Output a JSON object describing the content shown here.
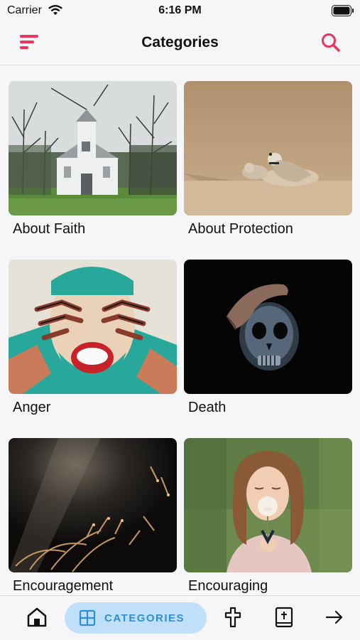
{
  "status": {
    "carrier": "Carrier",
    "time": "6:16 PM"
  },
  "header": {
    "title": "Categories"
  },
  "colors": {
    "accent": "#e8355a",
    "nav_active_bg": "#bfe0f8",
    "nav_active_fg": "#2f8fd4"
  },
  "categories": [
    {
      "label": "About Faith",
      "image": "white wooden chapel among bare trees"
    },
    {
      "label": "About Protection",
      "image": "two small birds on sand"
    },
    {
      "label": "Anger",
      "image": "graffiti of screaming face with hands"
    },
    {
      "label": "Death",
      "image": "hand over skull on black"
    },
    {
      "label": "Encouragement",
      "image": "dark field with light beam"
    },
    {
      "label": "Encouraging",
      "image": "woman blowing dandelion"
    }
  ],
  "nav": {
    "items": [
      {
        "icon": "home-icon"
      },
      {
        "icon": "grid-icon",
        "label": "CATEGORIES",
        "active": true
      },
      {
        "icon": "cross-icon"
      },
      {
        "icon": "bible-icon"
      },
      {
        "icon": "arrow-right-icon"
      }
    ]
  }
}
